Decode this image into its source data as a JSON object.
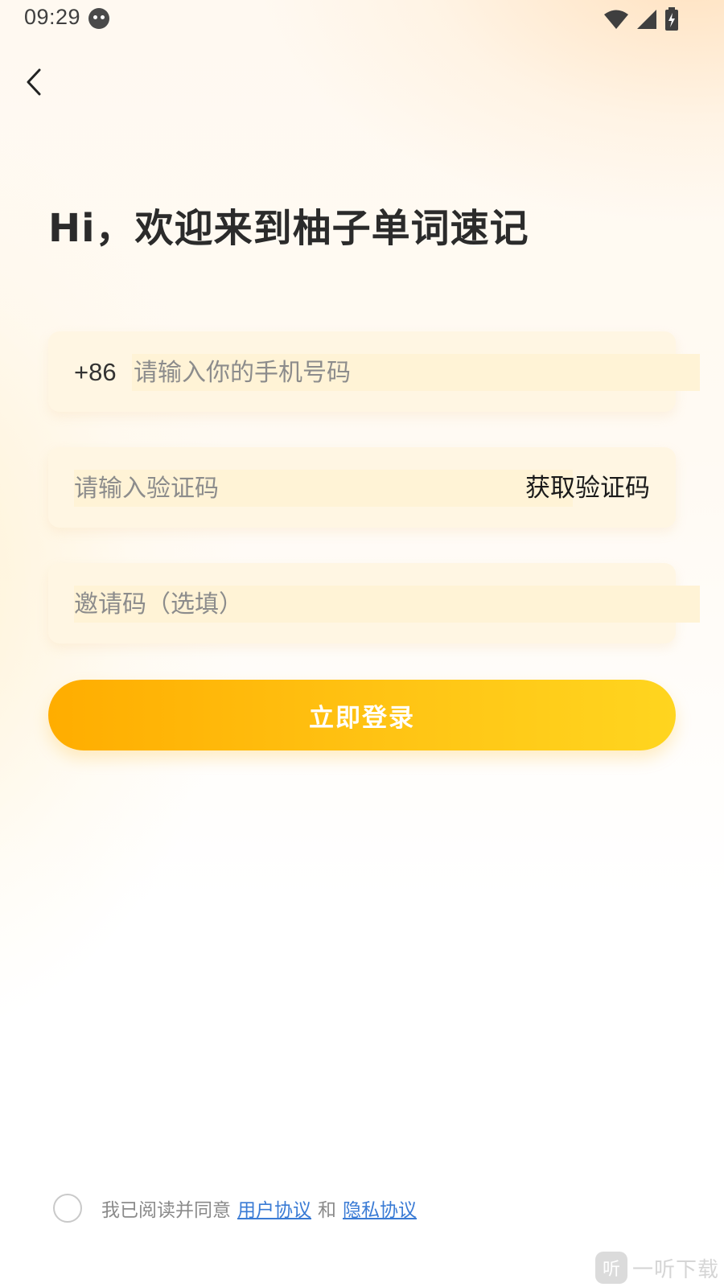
{
  "status_bar": {
    "time": "09:29",
    "icons": [
      "notification-face-icon",
      "wifi-icon",
      "cell-signal-icon",
      "battery-charging-icon"
    ]
  },
  "nav": {
    "back_icon": "chevron-left-icon"
  },
  "title": "Hi，欢迎来到柚子单词速记",
  "phone_field": {
    "prefix": "+86",
    "value": "",
    "placeholder": "请输入你的手机号码"
  },
  "code_field": {
    "value": "",
    "placeholder": "请输入验证码",
    "get_code_label": "获取验证码"
  },
  "invite_field": {
    "value": "",
    "placeholder": "邀请码（选填）"
  },
  "login_button": {
    "label": "立即登录"
  },
  "agreement": {
    "checked": false,
    "prefix": "我已阅读并同意",
    "user_agreement": "用户协议",
    "conjunction": "和",
    "privacy_agreement": "隐私协议"
  },
  "watermark": {
    "badge": "听",
    "text": "一听下载"
  },
  "colors": {
    "button_start": "#ffad00",
    "button_end": "#ffd51f",
    "field_bg": "#fff6e3",
    "link": "#3a7bd5",
    "title": "#2b2b2b"
  }
}
